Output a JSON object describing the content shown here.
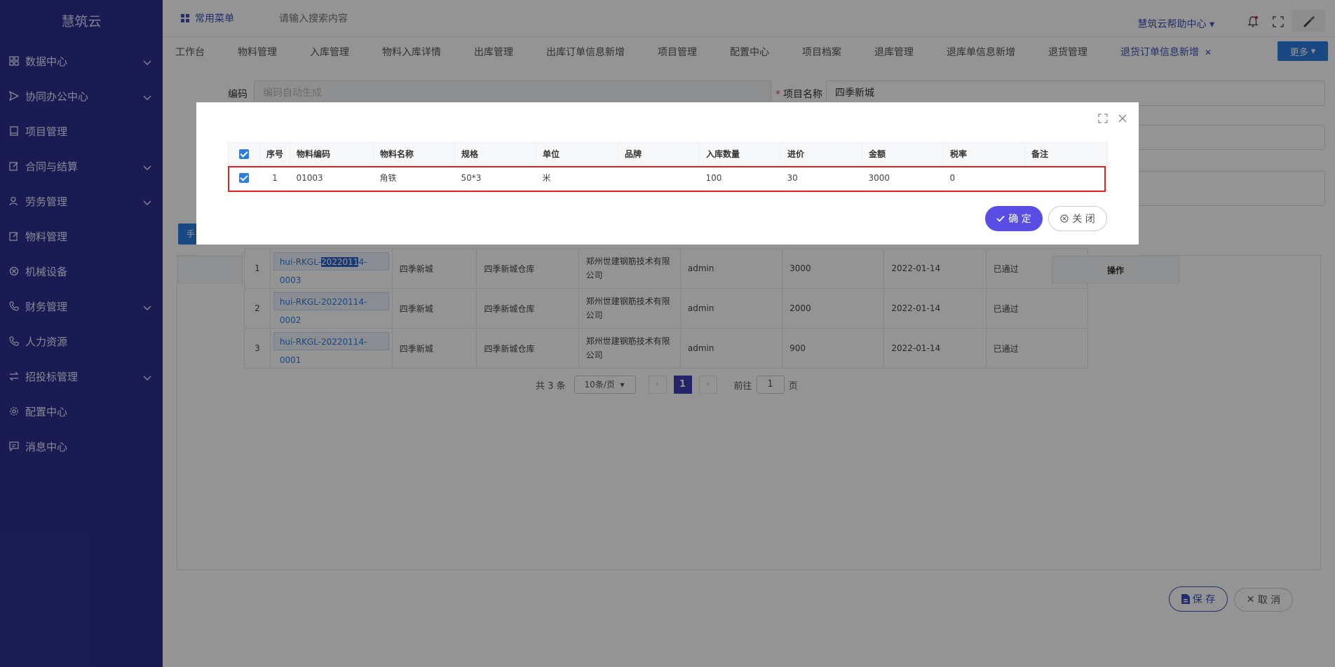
{
  "app": {
    "title": "慧筑云"
  },
  "sidebar": {
    "items": [
      {
        "label": "数据中心",
        "icon": "grid-icon",
        "expandable": true
      },
      {
        "label": "协同办公中心",
        "icon": "send-icon",
        "expandable": true
      },
      {
        "label": "项目管理",
        "icon": "book-icon",
        "expandable": false
      },
      {
        "label": "合同与结算",
        "icon": "edit-icon",
        "expandable": true
      },
      {
        "label": "劳务管理",
        "icon": "user-icon",
        "expandable": true
      },
      {
        "label": "物料管理",
        "icon": "edit-icon",
        "expandable": false
      },
      {
        "label": "机械设备",
        "icon": "circle-x-icon",
        "expandable": false
      },
      {
        "label": "财务管理",
        "icon": "phone-icon",
        "expandable": true
      },
      {
        "label": "人力资源",
        "icon": "phone-icon",
        "expandable": false
      },
      {
        "label": "招投标管理",
        "icon": "swap-icon",
        "expandable": true
      },
      {
        "label": "配置中心",
        "icon": "gear-icon",
        "expandable": false
      },
      {
        "label": "消息中心",
        "icon": "message-icon",
        "expandable": false
      }
    ]
  },
  "header": {
    "quick_menu": "常用菜单",
    "search_placeholder": "请输入搜索内容",
    "help": "慧筑云帮助中心"
  },
  "tabs": {
    "items": [
      "工作台",
      "物料管理",
      "入库管理",
      "物料入库详情",
      "出库管理",
      "出库订单信息新增",
      "项目管理",
      "配置中心",
      "项目档案",
      "退库管理",
      "退库单信息新增",
      "退货管理",
      "退货订单信息新增"
    ],
    "more": "更多"
  },
  "form": {
    "code_label": "编码",
    "code_placeholder": "编码自动生成",
    "project_label": "项目名称",
    "project_value": "四季新城",
    "hand_btn": "手"
  },
  "inner_list": {
    "op_header": "操作",
    "rows": [
      {
        "idx": "1",
        "code_pre": "hui-RKGL-",
        "code_hl": "2022011",
        "code_post": "4-0003",
        "project": "四季新城",
        "warehouse": "四季新城仓库",
        "supplier": "郑州世建钢筋技术有限公司",
        "user": "admin",
        "amount": "3000",
        "date": "2022-01-14",
        "status": "已通过"
      },
      {
        "idx": "2",
        "code_pre": "hui-RKGL-20220114-0002",
        "code_hl": "",
        "code_post": "",
        "project": "四季新城",
        "warehouse": "四季新城仓库",
        "supplier": "郑州世建钢筋技术有限公司",
        "user": "admin",
        "amount": "2000",
        "date": "2022-01-14",
        "status": "已通过"
      },
      {
        "idx": "3",
        "code_pre": "hui-RKGL-20220114-0001",
        "code_hl": "",
        "code_post": "",
        "project": "四季新城",
        "warehouse": "四季新城仓库",
        "supplier": "郑州世建钢筋技术有限公司",
        "user": "admin",
        "amount": "900",
        "date": "2022-01-14",
        "status": "已通过"
      }
    ],
    "pager": {
      "total": "共 3 条",
      "size": "10条/页",
      "current": "1",
      "goto": "前往",
      "goto_value": "1",
      "page_unit": "页"
    }
  },
  "modal": {
    "columns": [
      "序号",
      "物料编码",
      "物料名称",
      "规格",
      "单位",
      "品牌",
      "入库数量",
      "进价",
      "金额",
      "税率",
      "备注"
    ],
    "row": {
      "idx": "1",
      "code": "01003",
      "name": "角铁",
      "spec": "50*3",
      "unit": "米",
      "brand": "",
      "qty": "100",
      "price": "30",
      "amount": "3000",
      "tax": "0",
      "remark": ""
    },
    "ok": "确 定",
    "close": "关 闭"
  },
  "footer": {
    "save": "保 存",
    "cancel": "取 消"
  },
  "colors": {
    "sidebar": "#2f3090",
    "accent": "#3f51b5",
    "primary_btn": "#5a4de3",
    "highlight": "#e02424"
  }
}
